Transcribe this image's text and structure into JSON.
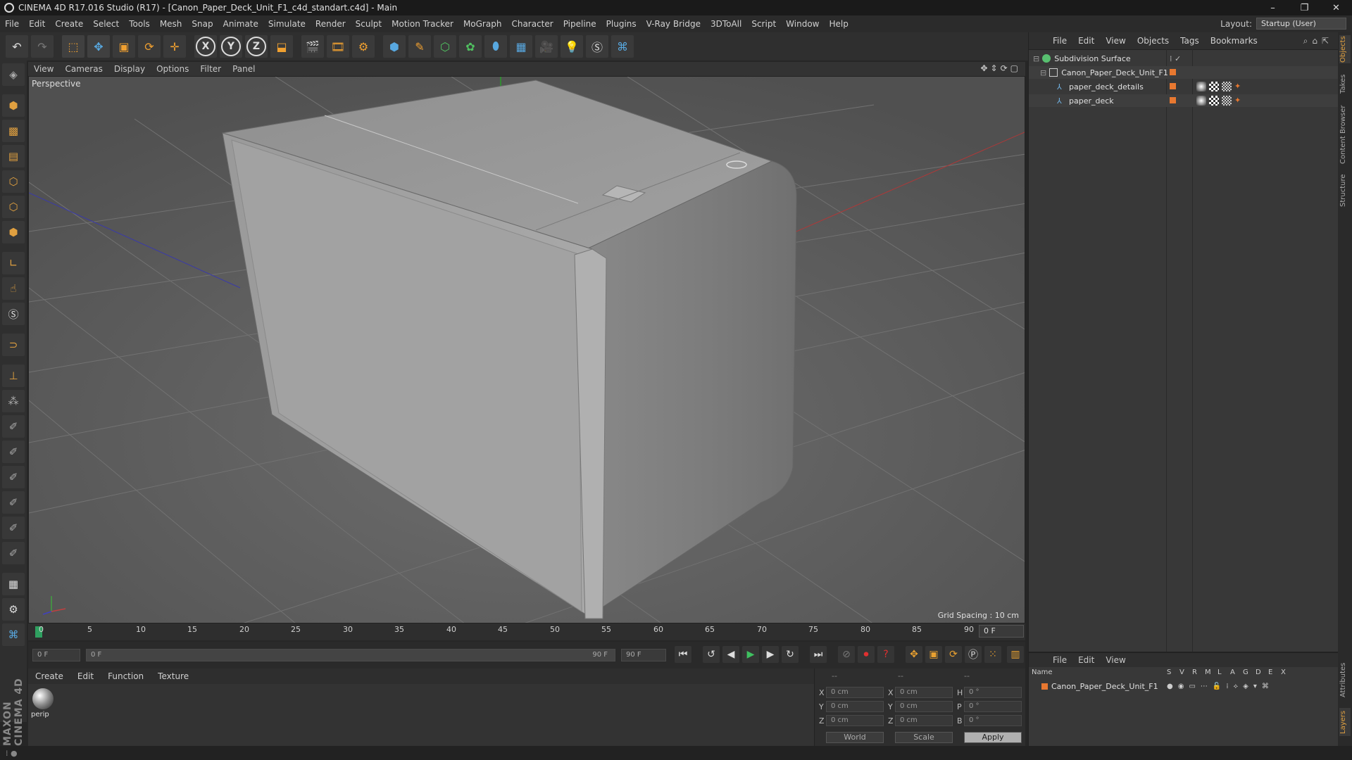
{
  "window": {
    "title": "CINEMA 4D R17.016 Studio (R17) - [Canon_Paper_Deck_Unit_F1_c4d_standart.c4d] - Main",
    "controls": [
      "–",
      "❐",
      "✕"
    ]
  },
  "menubar": {
    "items": [
      "File",
      "Edit",
      "Create",
      "Select",
      "Tools",
      "Mesh",
      "Snap",
      "Animate",
      "Simulate",
      "Render",
      "Sculpt",
      "Motion Tracker",
      "MoGraph",
      "Character",
      "Pipeline",
      "Plugins",
      "V-Ray Bridge",
      "3DToAll",
      "Script",
      "Window",
      "Help"
    ],
    "layout_label": "Layout:",
    "layout_value": "Startup (User)"
  },
  "toolbar": {
    "axis": [
      "X",
      "Y",
      "Z"
    ]
  },
  "viewport": {
    "menu": [
      "View",
      "Cameras",
      "Display",
      "Options",
      "Filter",
      "Panel"
    ],
    "label": "Perspective",
    "grid_spacing": "Grid Spacing : 10 cm",
    "nav_icons": "✥⇕⟳▢"
  },
  "timeline": {
    "ticks": [
      "0",
      "5",
      "10",
      "15",
      "20",
      "25",
      "30",
      "35",
      "40",
      "45",
      "50",
      "55",
      "60",
      "65",
      "70",
      "75",
      "80",
      "85",
      "90"
    ],
    "current_frame": "0 F",
    "start_field": "0 F",
    "range_start": "0 F",
    "range_end": "90 F",
    "end_field": "90 F"
  },
  "material_panel": {
    "menu": [
      "Create",
      "Edit",
      "Function",
      "Texture"
    ],
    "material_name": "perip"
  },
  "coordinates": {
    "header": [
      "--",
      "--",
      "--"
    ],
    "rows": [
      {
        "pos_label": "X",
        "pos": "0 cm",
        "size_label": "X",
        "size": "0 cm",
        "rot_label": "H",
        "rot": "0 °"
      },
      {
        "pos_label": "Y",
        "pos": "0 cm",
        "size_label": "Y",
        "size": "0 cm",
        "rot_label": "P",
        "rot": "0 °"
      },
      {
        "pos_label": "Z",
        "pos": "0 cm",
        "size_label": "Z",
        "size": "0 cm",
        "rot_label": "B",
        "rot": "0 °"
      }
    ],
    "mode": "World",
    "scale": "Scale",
    "apply": "Apply"
  },
  "object_manager": {
    "menu": [
      "File",
      "Edit",
      "View",
      "Objects",
      "Tags",
      "Bookmarks"
    ],
    "objects": [
      {
        "name": "Subdivision Surface",
        "color": "#58c070",
        "level": 0
      },
      {
        "name": "Canon_Paper_Deck_Unit_F1",
        "color": "#d0d0d0",
        "level": 1
      },
      {
        "name": "paper_deck_details",
        "color": "#70b0e0",
        "level": 2
      },
      {
        "name": "paper_deck",
        "color": "#70b0e0",
        "level": 2
      }
    ]
  },
  "layer_manager": {
    "menu": [
      "File",
      "Edit",
      "View"
    ],
    "columns": [
      "Name",
      "S",
      "V",
      "R",
      "M",
      "L",
      "A",
      "G",
      "D",
      "E",
      "X"
    ],
    "rows": [
      {
        "name": "Canon_Paper_Deck_Unit_F1",
        "color": "#e87830"
      }
    ]
  },
  "side_tabs": [
    "Objects",
    "Takes",
    "Content Browser",
    "Structure",
    "Attributes",
    "Layers"
  ],
  "colors": {
    "accent_orange": "#e87830",
    "viewport_bg": "#5a5a5a",
    "axis_x": "#c04040",
    "axis_y": "#40a040",
    "axis_z": "#4040c0"
  }
}
